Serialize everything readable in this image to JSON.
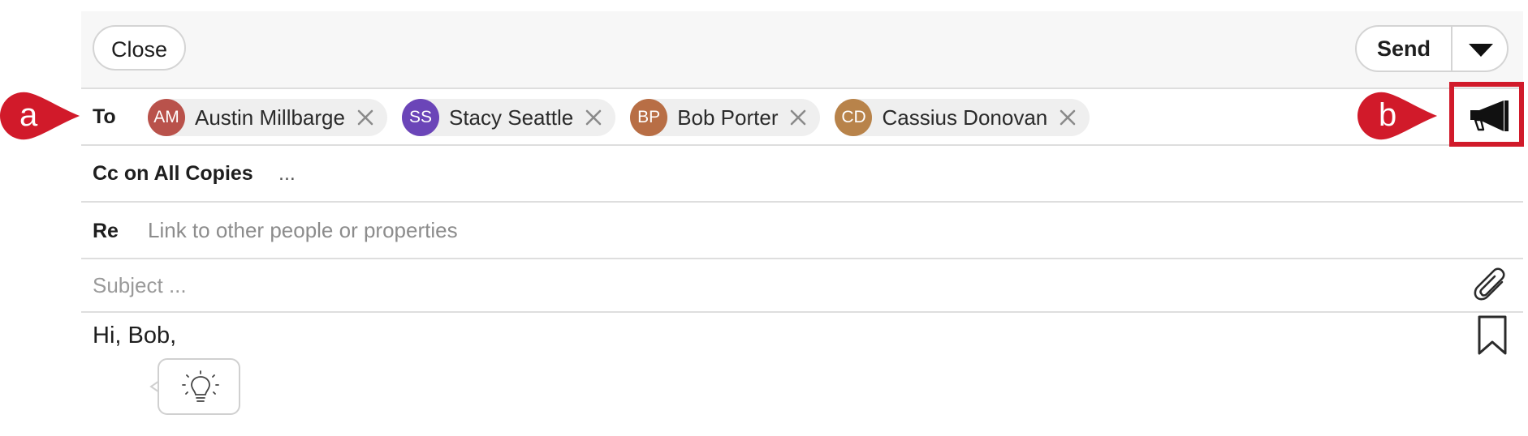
{
  "toolbar": {
    "close_label": "Close",
    "send_label": "Send"
  },
  "to": {
    "label": "To",
    "recipients": [
      {
        "initials": "AM",
        "name": "Austin Millbarge",
        "color": "#b9524b"
      },
      {
        "initials": "SS",
        "name": "Stacy Seattle",
        "color": "#6b45b8"
      },
      {
        "initials": "BP",
        "name": "Bob Porter",
        "color": "#b86e45"
      },
      {
        "initials": "CD",
        "name": "Cassius Donovan",
        "color": "#b8834a"
      }
    ]
  },
  "cc": {
    "label": "Cc on All Copies",
    "value": "..."
  },
  "re": {
    "label": "Re",
    "placeholder": "Link to other people or properties"
  },
  "subject": {
    "placeholder": "Subject ..."
  },
  "body": {
    "text": "Hi, Bob,"
  },
  "annotations": {
    "a_label": "a",
    "b_label": "b",
    "color": "#d11a2a"
  },
  "icons": {
    "send_options": "chevron-down-icon",
    "attachment": "paperclip-icon",
    "template": "bookmark-icon",
    "suggestion": "lightbulb-icon",
    "broadcast": "megaphone-icon"
  }
}
